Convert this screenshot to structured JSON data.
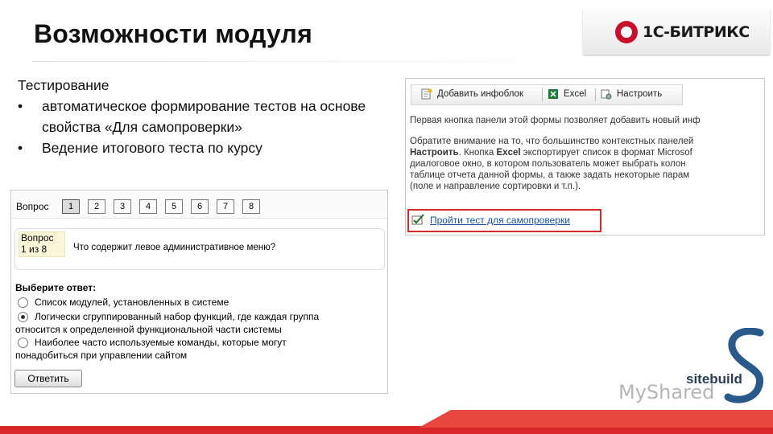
{
  "slide": {
    "title": "Возможности модуля",
    "logo_text": "1С-БИТРИКС",
    "body_heading": "Тестирование",
    "bullets": [
      "автоматическое формирование тестов на основе свойства «Для самопроверки»",
      "Ведение итогового теста по курсу"
    ]
  },
  "quiz": {
    "nav_label": "Вопрос",
    "question_numbers": [
      "1",
      "2",
      "3",
      "4",
      "5",
      "6",
      "7",
      "8"
    ],
    "active_question": "1",
    "counter_line1": "Вопрос",
    "counter_line2": "1 из 8",
    "question_text": "Что содержит левое административное меню?",
    "answer_title": "Выберите ответ:",
    "options": [
      {
        "line1": "Список модулей, установленных в системе",
        "line2": "",
        "selected": false
      },
      {
        "line1": "Логически сгруппированный набор функций, где каждая группа",
        "line2": "относится к определенной функциональной части системы",
        "selected": true
      },
      {
        "line1": "Наиболее часто используемые команды, которые могут",
        "line2": "понадобиться при управлении сайтом",
        "selected": false
      }
    ],
    "submit_label": "Ответить"
  },
  "admin_panel": {
    "toolbar": {
      "add_infoblock": "Добавить инфоблок",
      "excel": "Excel",
      "configure": "Настроить"
    },
    "para1": "Первая кнопка панели этой формы позволяет добавить новый инф",
    "para2_line1": "Обратите внимание на то, что большинство контекстных панелей",
    "para2_line2_bold": "Настроить",
    "para2_line2_mid": ". Кнопка ",
    "para2_line2_bold2": "Excel",
    "para2_line2_rest": " экспортирует список в формат Microsof",
    "para2_line3": "диалоговое окно, в котором пользователь может выбрать колон",
    "para2_line4": "таблице отчета данной формы, а также задать некоторые парам",
    "para2_line5": "(поле и направление сортировки и т.п.).",
    "self_test_link": "Пройти тест для самопроверки"
  },
  "footer": {
    "watermark": "MyShared",
    "sitebuild": "sitebuild"
  },
  "colors": {
    "accent_red": "#c8102e",
    "link_blue": "#1a4f9c",
    "highlight_border": "#d42a2a"
  }
}
